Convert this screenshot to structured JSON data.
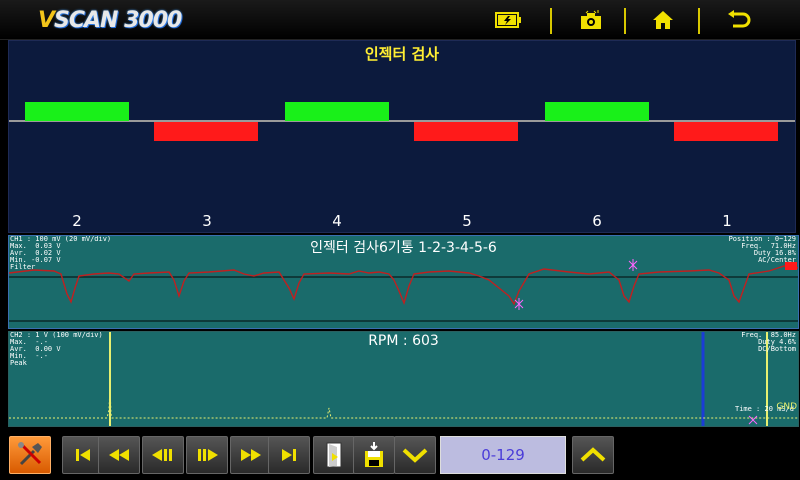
{
  "header": {
    "logo_v": "V",
    "logo_rest": "SCAN 3000",
    "icons": [
      "battery-icon",
      "camera-icon",
      "home-icon",
      "back-icon"
    ]
  },
  "injector_panel": {
    "title": "인젝터 검사",
    "cylinders": [
      "2",
      "3",
      "4",
      "5",
      "6",
      "1"
    ],
    "pulses": [
      "up",
      "down",
      "up",
      "down",
      "up",
      "down"
    ],
    "colors": {
      "up": "#19f019",
      "down": "#ff1a1a"
    }
  },
  "scope1": {
    "info_left": "CH1 : 100 mV (20 mV/div)\nMax.  0.03 V\nAvr.  0.02 V\nMin. -0.07 V\nFilter",
    "info_right": "Position : 0~129\nFreq.  71.0Hz\nDuty 16.8%\nAC/Center",
    "title": "인젝터 검사6기통 1-2-3-4-5-6"
  },
  "scope2": {
    "info_left": "CH2 : 1 V (100 mV/div)\nMax.  -.-\nAvr.  0.00 V\nMin.  -.-\nPeak",
    "info_right": "Freq.  85.0Hz\nDuty 4.6%\nDC/Bottom",
    "title": "RPM : 603",
    "gnd_label": "GND",
    "time_label": "Time : 20 mS/d"
  },
  "footer": {
    "range": "0-129",
    "buttons": [
      "tools",
      "first",
      "rewind",
      "step-back",
      "step-forward",
      "fast-forward",
      "last",
      "exit",
      "save",
      "down",
      "up"
    ]
  }
}
